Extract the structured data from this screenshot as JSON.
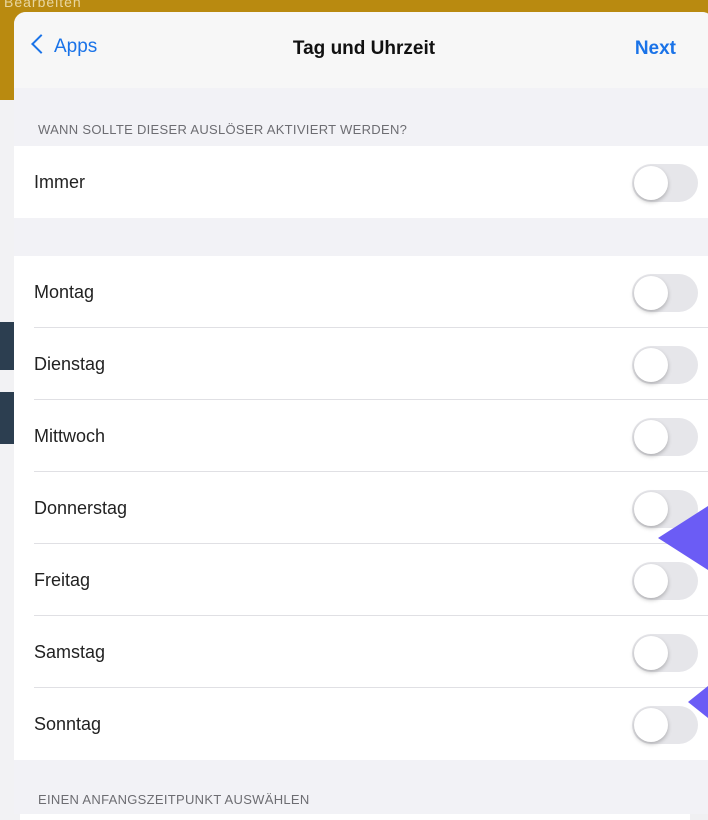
{
  "background": {
    "app_name_partial": "Bearbeiten"
  },
  "navbar": {
    "back_label": "Apps",
    "title": "Tag und Uhrzeit",
    "next_label": "Next"
  },
  "trigger_section": {
    "header": "WANN SOLLTE DIESER AUSLÖSER AKTIVIERT WERDEN?",
    "always": {
      "label": "Immer",
      "on": false
    }
  },
  "days": [
    {
      "label": "Montag",
      "on": false
    },
    {
      "label": "Dienstag",
      "on": false
    },
    {
      "label": "Mittwoch",
      "on": false
    },
    {
      "label": "Donnerstag",
      "on": false
    },
    {
      "label": "Freitag",
      "on": false
    },
    {
      "label": "Samstag",
      "on": false
    },
    {
      "label": "Sonntag",
      "on": false
    }
  ],
  "start_section": {
    "header": "EINEN ANFANGSZEITPUNKT AUSWÄHLEN"
  },
  "colors": {
    "accent": "#1a73e8",
    "annotation_arrow": "#6b5cf5",
    "backdrop": "#b98a10"
  }
}
